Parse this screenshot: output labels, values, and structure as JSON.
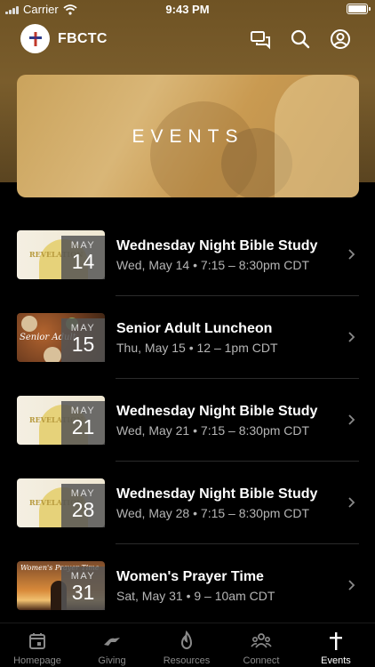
{
  "status_bar": {
    "carrier": "Carrier",
    "time": "9:43 PM"
  },
  "header": {
    "app_name": "FBCTC",
    "icons": [
      "chat-icon",
      "search-icon",
      "profile-icon"
    ]
  },
  "banner": {
    "title": "EVENTS"
  },
  "events": [
    {
      "month": "MAY",
      "day": "14",
      "title": "Wednesday Night Bible Study",
      "subtitle": "Wed, May 14 • 7:15 – 8:30pm CDT",
      "thumbnail": "bible-study"
    },
    {
      "month": "MAY",
      "day": "15",
      "title": "Senior Adult Luncheon",
      "subtitle": "Thu, May 15 • 12 – 1pm CDT",
      "thumbnail": "luncheon"
    },
    {
      "month": "MAY",
      "day": "21",
      "title": "Wednesday Night Bible Study",
      "subtitle": "Wed, May 21 • 7:15 – 8:30pm CDT",
      "thumbnail": "bible-study"
    },
    {
      "month": "MAY",
      "day": "28",
      "title": "Wednesday Night Bible Study",
      "subtitle": "Wed, May 28 • 7:15 – 8:30pm CDT",
      "thumbnail": "bible-study"
    },
    {
      "month": "MAY",
      "day": "31",
      "title": "Women's Prayer Time",
      "subtitle": "Sat, May 31 • 9 – 10am CDT",
      "thumbnail": "prayer"
    }
  ],
  "thumb_text": {
    "bible_study": "REVELATION",
    "luncheon": "Senior Adult",
    "prayer": "Women's Prayer Time"
  },
  "tabs": [
    {
      "label": "Homepage",
      "icon": "calendar-icon",
      "active": false
    },
    {
      "label": "Giving",
      "icon": "hands-icon",
      "active": false
    },
    {
      "label": "Resources",
      "icon": "flame-icon",
      "active": false
    },
    {
      "label": "Connect",
      "icon": "people-icon",
      "active": false
    },
    {
      "label": "Events",
      "icon": "cross-icon",
      "active": true
    }
  ],
  "colors": {
    "header_bg": "#7a5d2c",
    "banner_bg": "#d9b677",
    "background": "#000000",
    "inactive_tab": "#8a8a8a"
  }
}
